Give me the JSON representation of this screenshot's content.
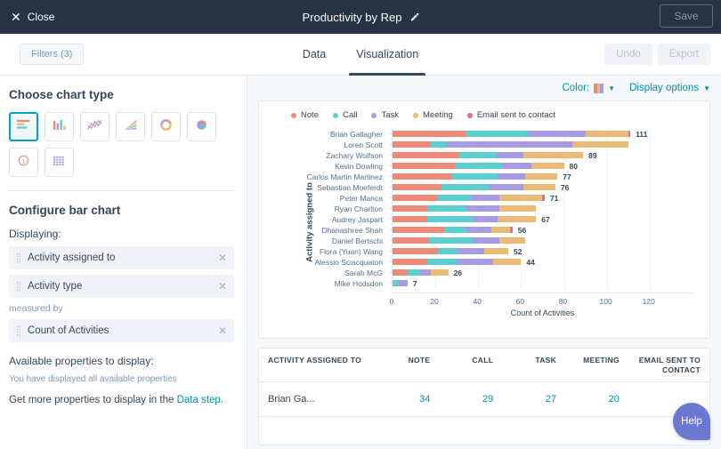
{
  "topbar": {
    "close_label": "Close",
    "title": "Productivity by Rep",
    "edit_icon": "pencil-icon",
    "save_label": "Save"
  },
  "subbar": {
    "filters_label": "Filters (3)",
    "tabs": [
      {
        "label": "Data",
        "active": false
      },
      {
        "label": "Visualization",
        "active": true
      }
    ],
    "undo_label": "Undo",
    "export_label": "Export"
  },
  "sidebar": {
    "chart_type_heading": "Choose chart type",
    "chart_types": [
      {
        "name": "horizontal-bar-chart-icon",
        "selected": true
      },
      {
        "name": "vertical-bar-chart-icon",
        "selected": false
      },
      {
        "name": "line-chart-icon",
        "selected": false
      },
      {
        "name": "area-chart-icon",
        "selected": false
      },
      {
        "name": "donut-chart-icon",
        "selected": false
      },
      {
        "name": "pie-chart-icon",
        "selected": false
      },
      {
        "name": "single-number-icon",
        "selected": false
      },
      {
        "name": "data-table-icon",
        "selected": false
      }
    ],
    "configure_heading": "Configure bar chart",
    "displaying_label": "Displaying:",
    "displaying_chips": [
      "Activity assigned to",
      "Activity type"
    ],
    "measured_by_label": "measured by",
    "measure_chip": "Count of Activities",
    "available_heading": "Available properties to display:",
    "available_note": "You have displayed all available properties",
    "more_prefix": "Get more properties to display in the ",
    "more_link": "Data step."
  },
  "main": {
    "color_label": "Color:",
    "display_options_label": "Display options"
  },
  "chart_data": {
    "type": "bar",
    "orientation": "horizontal",
    "stacked": true,
    "title": "",
    "xlabel": "Count of Activities",
    "ylabel": "Activity assigned to",
    "xlim": [
      0,
      128
    ],
    "xticks": [
      0,
      20,
      40,
      60,
      80,
      100,
      120
    ],
    "grid": true,
    "legend_position": "top-left",
    "legend": [
      "Note",
      "Call",
      "Task",
      "Meeting",
      "Email sent to contact"
    ],
    "colors": {
      "Note": "#ed8b76",
      "Call": "#5ecfcf",
      "Task": "#a99ae5",
      "Meeting": "#eaba76",
      "Email sent to contact": "#e islands"
    },
    "series_colors": [
      "#ed8b76",
      "#5ecfcf",
      "#a99ae5",
      "#eaba76",
      "#e06c9f"
    ],
    "categories": [
      "Brian Gallagher",
      "Loren Scott",
      "Zachary Wolfson",
      "Kevin Dowling",
      "Carlos Martin Martinez",
      "Sebastian Moeferdt",
      "Peter Manca",
      "Ryan Charlton",
      "Audrey Jaspart",
      "Dhanashree Shah",
      "Daniel Bertschi",
      "Flora (Yuan) Wang",
      "Alessio Sciacquatori",
      "Sarah McG",
      "Mike Hodsdon"
    ],
    "series": [
      {
        "name": "Note",
        "values": [
          34,
          18,
          31,
          29,
          28,
          23,
          21,
          16,
          16,
          24,
          17,
          21,
          16,
          7,
          0
        ]
      },
      {
        "name": "Call",
        "values": [
          29,
          7,
          17,
          22,
          21,
          22,
          16,
          18,
          22,
          10,
          21,
          9,
          14,
          6,
          3
        ]
      },
      {
        "name": "Task",
        "values": [
          27,
          59,
          13,
          14,
          13,
          16,
          13,
          16,
          11,
          12,
          12,
          13,
          17,
          5,
          4
        ]
      },
      {
        "name": "Meeting",
        "values": [
          20,
          26,
          28,
          15,
          15,
          15,
          20,
          17,
          18,
          9,
          12,
          11,
          13,
          8,
          0
        ]
      },
      {
        "name": "Email sent to contact",
        "values": [
          1,
          0,
          0,
          0,
          0,
          0,
          1,
          0,
          0,
          1,
          0,
          0,
          0,
          0,
          0
        ]
      }
    ],
    "totals": [
      111,
      110,
      89,
      80,
      77,
      76,
      71,
      67,
      67,
      56,
      62,
      52,
      44,
      26,
      7
    ],
    "labeled_totals": {
      "Brian Gallagher": "111",
      "Loren Scott": "",
      "Zachary Wolfson": "89",
      "Kevin Dowling": "80",
      "Carlos Martin Martinez": "77",
      "Sebastian Moeferdt": "76",
      "Peter Manca": "71",
      "Ryan Charlton": "",
      "Audrey Jaspart": "67",
      "Dhanashree Shah": "56",
      "Daniel Bertschi": "",
      "Flora (Yuan) Wang": "52",
      "Alessio Sciacquatori": "44",
      "Sarah McG": "26",
      "Mike Hodsdon": "7"
    }
  },
  "table": {
    "headers": [
      "ACTIVITY ASSIGNED TO",
      "NOTE",
      "CALL",
      "TASK",
      "MEETING",
      "EMAIL SENT TO CONTACT"
    ],
    "rows": [
      {
        "name": "Brian Ga...",
        "note": "34",
        "call": "29",
        "task": "27",
        "meeting": "20",
        "email": ""
      }
    ]
  },
  "help": {
    "label": "Help"
  }
}
